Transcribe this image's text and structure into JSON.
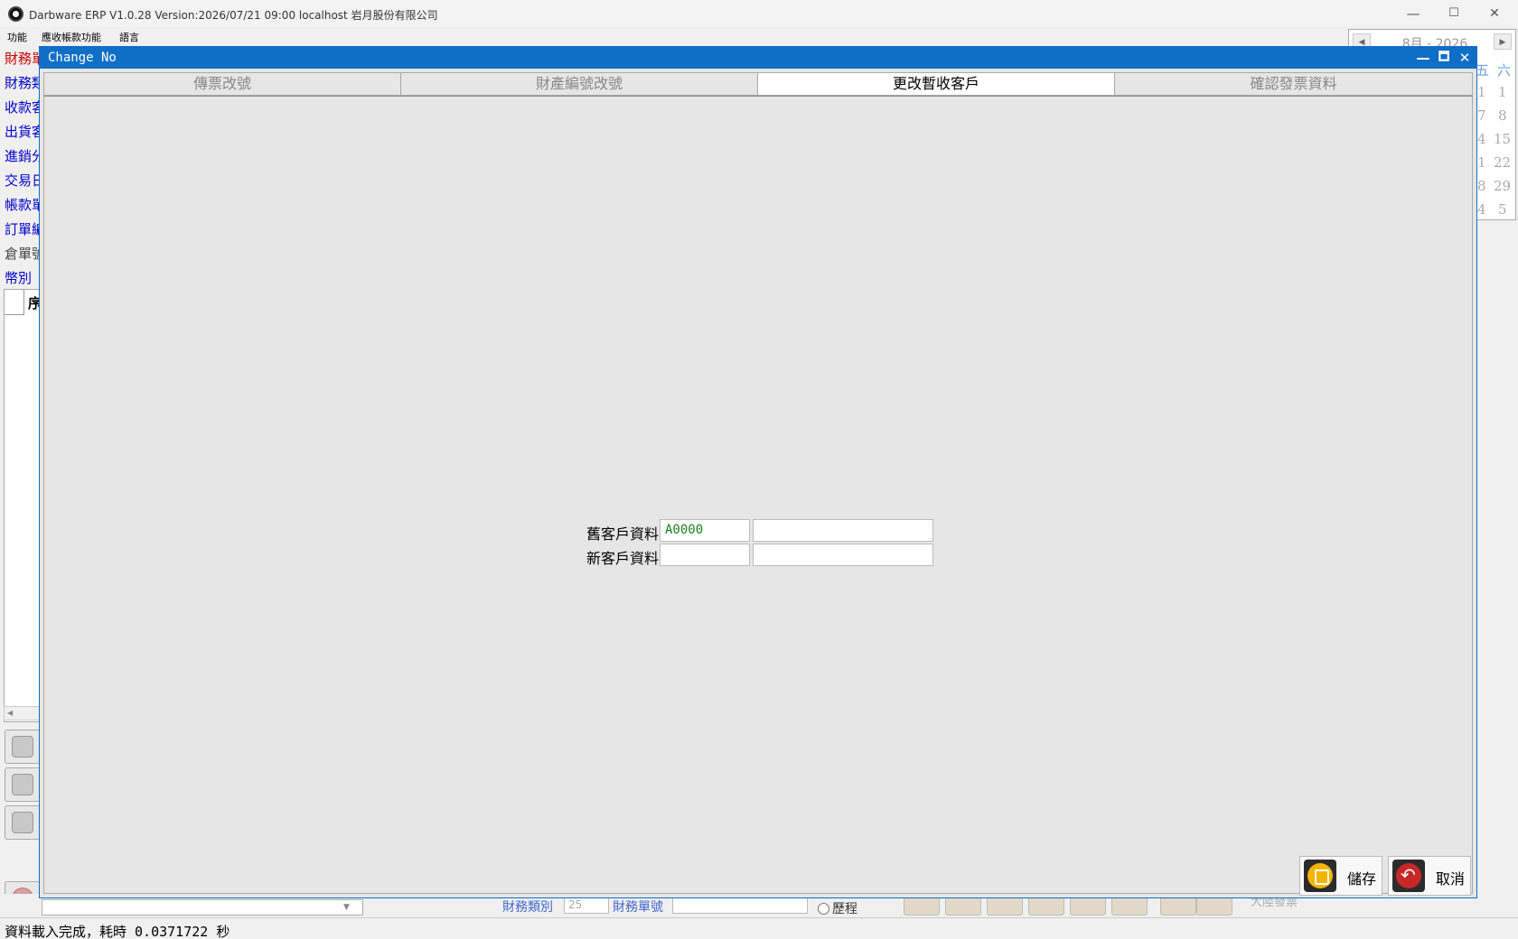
{
  "app": {
    "title": "Darbware ERP V1.0.28 Version:2026/07/21 09:00   localhost 岩月股份有限公司",
    "window_controls": {
      "minimize": "—",
      "maximize": "☐",
      "close": "✕"
    }
  },
  "menu": {
    "items": [
      "功能",
      "應收帳款功能",
      "語言"
    ]
  },
  "calendar": {
    "header": "8月 - 2026",
    "prev": "◀",
    "next": "▶",
    "weekdays": [
      "五",
      "六"
    ],
    "days": [
      [
        "1",
        "1"
      ],
      [
        "7",
        "8"
      ],
      [
        "4",
        "15"
      ],
      [
        "1",
        "22"
      ],
      [
        "8",
        "29"
      ],
      [
        "4",
        "5"
      ]
    ]
  },
  "sidebar": {
    "labels": [
      "財務單",
      "財務類",
      "收款客",
      "出貨客",
      "進銷分",
      "交易日",
      "帳款單",
      "訂單編",
      "倉單號",
      "幣別"
    ],
    "grid_header": "序",
    "scroll_left": "◀"
  },
  "bg_toolbar": {
    "finance_category_label": "財務類別",
    "finance_category_value": "25",
    "finance_number_label": "財務單號",
    "history_label": "歷程",
    "invoice_label": "大陸發票"
  },
  "dialog": {
    "title": "Change No",
    "controls": {
      "minimize": "—",
      "maximize": "🗖",
      "close": "✕"
    },
    "tabs": [
      "傳票改號",
      "財產編號改號",
      "更改暫收客戶",
      "確認發票資料"
    ],
    "active_tab": 2,
    "form": {
      "old_customer_label": "舊客戶資料",
      "old_customer_code": "A0000",
      "old_customer_name": "",
      "new_customer_label": "新客戶資料",
      "new_customer_code": "",
      "new_customer_name": ""
    },
    "buttons": {
      "save": "儲存",
      "cancel": "取消"
    }
  },
  "status": {
    "text": "資料載入完成，耗時 0.0371722 秒"
  },
  "colors": {
    "dialog_title": "#0f6fc6",
    "link_blue": "#0000cc",
    "field_text": "#1c7c1c"
  }
}
